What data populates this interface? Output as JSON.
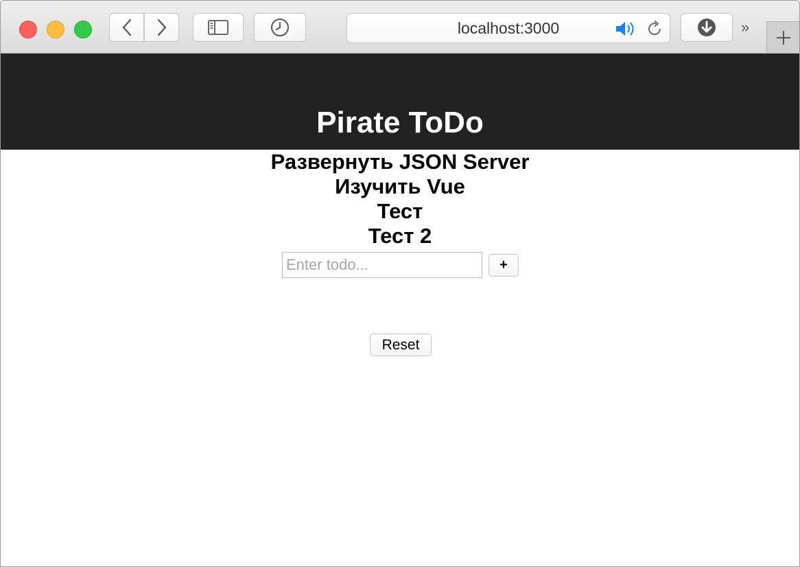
{
  "browser": {
    "url": "localhost:3000",
    "icons": [
      "back-icon",
      "forward-icon",
      "sidebar-icon",
      "history-icon",
      "speaker-icon",
      "reload-icon",
      "download-icon",
      "more-icon",
      "new-tab-icon"
    ],
    "more_label": "»"
  },
  "header": {
    "title": "Pirate ToDo",
    "background": "#222222"
  },
  "todos": [
    {
      "text": "Развернуть JSON Server"
    },
    {
      "text": "Изучить Vue"
    },
    {
      "text": "Тест"
    },
    {
      "text": "Тест 2"
    }
  ],
  "form": {
    "placeholder": "Enter todo...",
    "value": "",
    "add_label": "+"
  },
  "reset_label": "Reset"
}
